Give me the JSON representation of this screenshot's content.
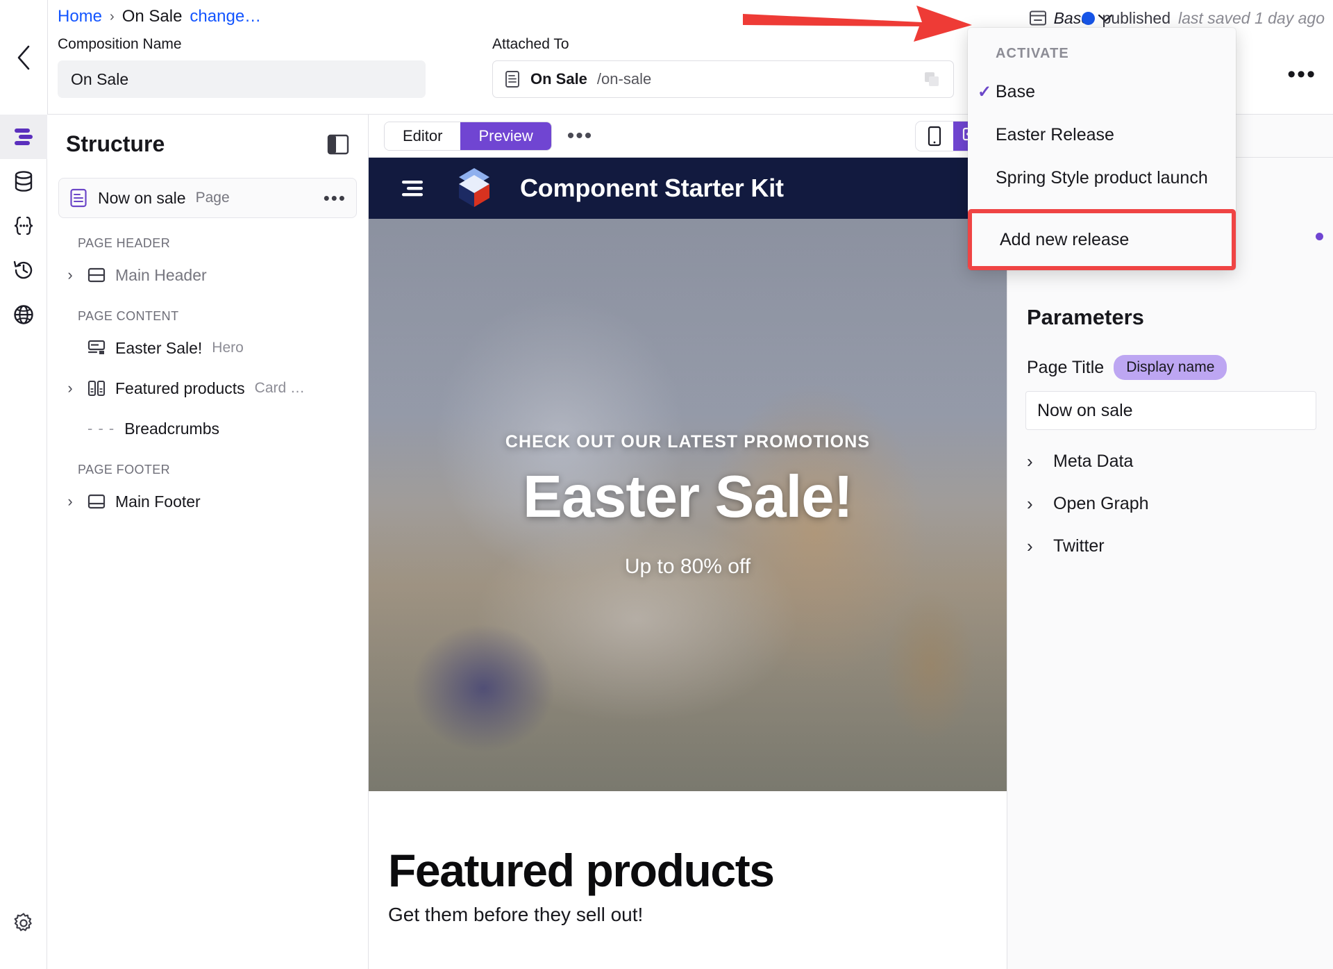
{
  "topbar": {
    "breadcrumb": {
      "home": "Home",
      "separator": "›",
      "current": "On Sale",
      "change": "change…"
    },
    "composition_name_label": "Composition Name",
    "composition_name_value": "On Sale",
    "attached_to_label": "Attached To",
    "attached_name": "On Sale",
    "attached_path": "/on-sale",
    "release_name": "Base",
    "status_text": "published",
    "saved_text": "last saved 1 day ago",
    "status_color": "#1755e8",
    "more_dots": "•••"
  },
  "release_menu": {
    "section_label": "ACTIVATE",
    "items": [
      {
        "label": "Base",
        "checked": true
      },
      {
        "label": "Easter Release",
        "checked": false
      },
      {
        "label": "Spring Style product launch",
        "checked": false
      }
    ],
    "add_label": "Add new release",
    "highlight_color": "#ef4444",
    "check_glyph": "✓"
  },
  "rail": {
    "items": [
      {
        "name": "structure-icon",
        "active": true
      },
      {
        "name": "data-icon",
        "active": false
      },
      {
        "name": "variables-icon",
        "active": false
      },
      {
        "name": "history-icon",
        "active": false
      },
      {
        "name": "globe-icon",
        "active": false
      }
    ],
    "settings": "gear-icon"
  },
  "structure": {
    "title": "Structure",
    "page": {
      "name": "Now on sale",
      "type": "Page",
      "dots": "•••"
    },
    "groups": [
      {
        "label": "PAGE HEADER",
        "rows": [
          {
            "caret": "›",
            "label": "Main Header",
            "sub": "",
            "muted": true,
            "icon": "header-layout-icon"
          }
        ]
      },
      {
        "label": "PAGE CONTENT",
        "rows": [
          {
            "caret": "",
            "label": "Easter Sale!",
            "sub": "Hero",
            "muted": false,
            "icon": "hero-icon"
          },
          {
            "caret": "›",
            "label": "Featured products",
            "sub": "Card …",
            "muted": false,
            "icon": "cards-icon"
          },
          {
            "caret": "",
            "label": "Breadcrumbs",
            "sub": "",
            "muted": false,
            "icon": "dashes-icon"
          }
        ]
      },
      {
        "label": "PAGE FOOTER",
        "rows": [
          {
            "caret": "›",
            "label": "Main Footer",
            "sub": "",
            "muted": false,
            "icon": "footer-layout-icon"
          }
        ]
      }
    ]
  },
  "center": {
    "tabs": [
      {
        "label": "Editor",
        "active": false
      },
      {
        "label": "Preview",
        "active": true
      }
    ],
    "dots": "•••",
    "devices": [
      {
        "name": "mobile-icon",
        "active": false
      },
      {
        "name": "desktop-icon",
        "active": true
      }
    ],
    "accent": "#7045d2"
  },
  "preview": {
    "site_title": "Component Starter Kit",
    "hero": {
      "eyebrow": "CHECK OUT OUR LATEST PROMOTIONS",
      "title": "Easter Sale!",
      "subtitle": "Up to 80% off"
    },
    "featured": {
      "title": "Featured products",
      "subtitle": "Get them before they sell out!"
    }
  },
  "parameters": {
    "title": "Parameters",
    "page_title_label": "Page Title",
    "display_badge": "Display name",
    "page_title_value": "Now on sale",
    "accordions": [
      {
        "caret": "›",
        "label": "Meta Data"
      },
      {
        "caret": "›",
        "label": "Open Graph"
      },
      {
        "caret": "›",
        "label": "Twitter"
      }
    ]
  }
}
